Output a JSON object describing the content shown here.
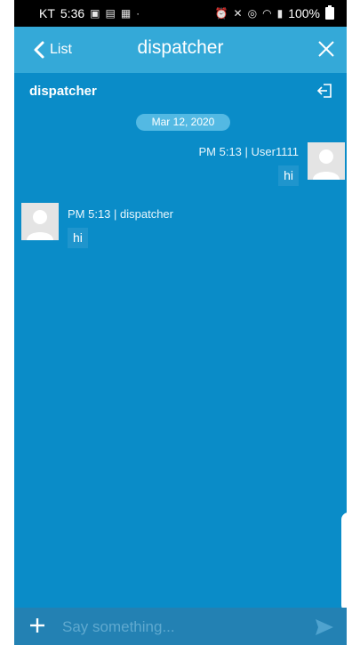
{
  "status_bar": {
    "carrier": "KT",
    "time": "5:36",
    "battery": "100%"
  },
  "nav": {
    "back_label": "List",
    "title": "dispatcher"
  },
  "chat": {
    "room_name": "dispatcher",
    "date": "Mar 12, 2020"
  },
  "messages": [
    {
      "meta": "PM 5:13 | User1111",
      "text": "hi"
    },
    {
      "meta": "PM 5:13 | dispatcher",
      "text": "hi"
    }
  ],
  "composer": {
    "placeholder": "Say something..."
  },
  "colors": {
    "background": "#0a8cc8",
    "topbar": "#34a9d8",
    "composer": "#2381b3"
  }
}
